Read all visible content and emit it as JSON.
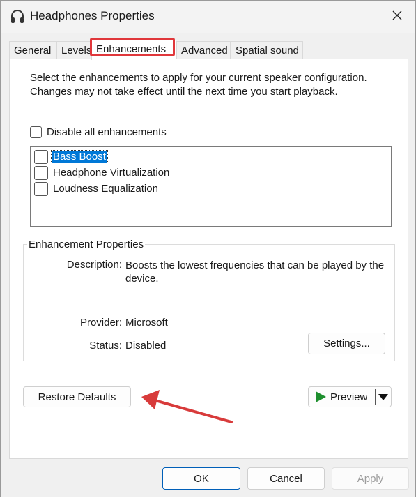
{
  "window": {
    "title": "Headphones Properties",
    "icon": "headphones-icon",
    "close_icon": "close-icon"
  },
  "tabs": [
    {
      "label": "General",
      "active": false
    },
    {
      "label": "Levels",
      "active": false
    },
    {
      "label": "Enhancements",
      "active": true
    },
    {
      "label": "Advanced",
      "active": false
    },
    {
      "label": "Spatial sound",
      "active": false
    }
  ],
  "enhancements": {
    "intro": "Select the enhancements to apply for your current speaker configuration. Changes may not take effect until the next time you start playback.",
    "disable_all_label": "Disable all enhancements",
    "items": [
      {
        "label": "Bass Boost",
        "selected": true,
        "checked": false
      },
      {
        "label": "Headphone Virtualization",
        "selected": false,
        "checked": false
      },
      {
        "label": "Loudness Equalization",
        "selected": false,
        "checked": false
      }
    ]
  },
  "properties": {
    "group_title": "Enhancement Properties",
    "description_label": "Description:",
    "description_value": "Boosts the lowest frequencies that can be played by the device.",
    "provider_label": "Provider:",
    "provider_value": "Microsoft",
    "status_label": "Status:",
    "status_value": "Disabled",
    "settings_button": "Settings..."
  },
  "actions": {
    "restore_defaults": "Restore Defaults",
    "preview": "Preview"
  },
  "footer": {
    "ok": "OK",
    "cancel": "Cancel",
    "apply": "Apply"
  },
  "colors": {
    "selection": "#0078d7",
    "highlight": "#e0373b",
    "preview_play": "#1e8f2e",
    "default_button_border": "#005fb8"
  }
}
